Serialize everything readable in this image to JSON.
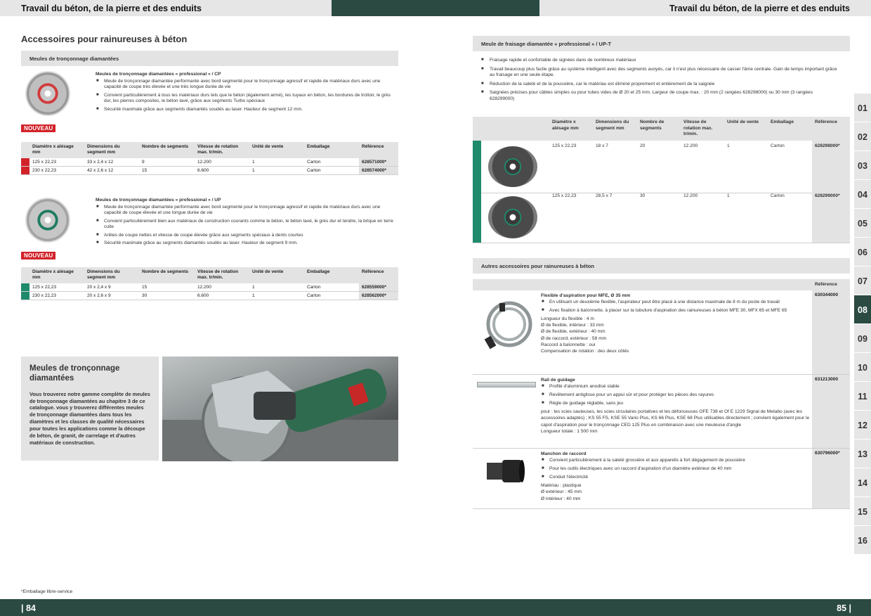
{
  "header": {
    "left_title": "Travail du béton, de la pierre et des enduits",
    "right_title": "Travail du béton, de la pierre et des enduits"
  },
  "left": {
    "section_title": "Accessoires pour rainureuses à béton",
    "subsection_bar": "Meules de tronçonnage diamantées",
    "cp": {
      "title": "Meules de tronçonnage diamantées « professional » / CP",
      "bullets": [
        "Meule de tronçonnage diamantée performante avec bord segmenté pour le tronçonnage agressif et rapide de matériaux durs avec une capacité de coupe très élevée et une très longue durée de vie",
        "Convient particulièrement à tous les matériaux durs tels que le béton (également armé), les tuyaux en béton, les bordures de trottoir, le grès dur, les pierres composites, le béton lavé, grâce aux segments Turbo spéciaux",
        "Sécurité maximale grâce aux segments diamantés soudés au laser. Hauteur de segment 12 mm."
      ],
      "badge": "NOUVEAU",
      "headers": [
        "Diamètre x alésage mm",
        "Dimensions du segment mm",
        "Nombre de segments",
        "Vitesse de rotation max. tr/min.",
        "Unité de vente",
        "Emballage",
        "Référence"
      ],
      "rows": [
        [
          "125 x 22,23",
          "33 x 2,4 x 12",
          "9",
          "12.200",
          "1",
          "Carton",
          "628571000*"
        ],
        [
          "230 x 22,23",
          "42 x 2,6 x 12",
          "15",
          "6.600",
          "1",
          "Carton",
          "628574000*"
        ]
      ]
    },
    "up": {
      "title": "Meules de tronçonnage diamantées « professional » / UP",
      "bullets": [
        "Meule de tronçonnage diamantée performante avec bord segmenté pour le tronçonnage agressif et rapide de matériaux durs avec une capacité de coupe élevée et une longue durée de vie",
        "Convient particulièrement bien aux matériaux de construction courants comme le béton, le béton lavé, le grès dur et tendre, la brique en terre cuite",
        "Arêtes de coupe nettes et vitesse de coupe élevée grâce aux segments spéciaux à dents courtes",
        "Sécurité maximale grâce au segments diamantés soudés au laser. Hauteur de segment 9 mm."
      ],
      "badge": "NOUVEAU",
      "headers": [
        "Diamètre x alésage mm",
        "Dimensions du segment mm",
        "Nombre de segments",
        "Vitesse de rotation max. tr/min.",
        "Unité de vente",
        "Emballage",
        "Référence"
      ],
      "rows": [
        [
          "125 x 22,23",
          "20 x 2,4 x 9",
          "15",
          "12.200",
          "1",
          "Carton",
          "628559000*"
        ],
        [
          "230 x 22,23",
          "20 x 2,6 x 9",
          "30",
          "6.600",
          "1",
          "Carton",
          "628562000*"
        ]
      ]
    },
    "promo": {
      "title": "Meules de tronçonnage diamantées",
      "text": "Vous trouverez notre gamme complète de meules de tronçonnage diamantées au chapitre 3 de ce catalogue. vous y trouverez différentes meules de tronçonnage diamantées dans tous les diamètres et les classes de qualité nécessaires pour toutes les applications comme la découpe de béton, de granit, de carrelage et d'autres matériaux de construction."
    },
    "footnote": "*Emballage libre-service",
    "page_number": "| 84"
  },
  "right": {
    "upt_bar": "Meule de fraisage diamantée « professional » / UP-T",
    "upt_bullets": [
      "Fraisage rapide et confortable de signées dans de nombreux matériaux",
      "Travail beaucoup plus facile grâce au système intelligent avec des segments avoyés, car il n'est plus nécessaire de casser l'âme centrale. Gain de temps important grâce au fraisage en une seule étape.",
      "Réduction de la saleté et de la poussière, car le matériau est éliminé proprement et entièrement de la saignée",
      "Saignées précises pour câbles simples ou pour tubes vides de Ø 20 et 25 mm. Largeur de coupe max. : 20 mm (2 rangées 628298000) ou 30 mm (3 rangées 628299000)"
    ],
    "upt_headers": [
      "Diamètre x alésage mm",
      "Dimensions du segment mm",
      "Nombre de segments",
      "Vitesse de rotation max. tr/min.",
      "Unité de vente",
      "Emballage",
      "Référence"
    ],
    "upt_rows": [
      [
        "125 x 22,23",
        "18 x 7",
        "20",
        "12.200",
        "1",
        "Carton",
        "628298000*"
      ],
      [
        "125 x 22,23",
        "28,5 x 7",
        "30",
        "12.200",
        "1",
        "Carton",
        "628299000*"
      ]
    ],
    "acc_bar": "Autres accessoires pour rainureuses à béton",
    "acc_ref_header": "Référence",
    "accessories": [
      {
        "title": "Flexible d'aspiration pour MFE, Ø 35 mm",
        "bullets": [
          "En utilisant un deuxième flexible, l'aspirateur peut être placé à une distance maximale de 8 m du poste de travail",
          "Avec fixation à baïonnette, à placer sur la tubulure d'aspiration des rainureuses à béton MFE 30, MFX 65 et MFE 65"
        ],
        "lines": [
          "Longueur du flexible : 4 m",
          "Ø de flexible, intérieur : 33 mm",
          "Ø de flexible, extérieur : 40 mm",
          "Ø de raccord, extérieur : 58 mm",
          "Raccord à baïonnette : oui",
          "Compensation de rotation : des deux côtés"
        ],
        "ref": "630344000"
      },
      {
        "title": "Rail de guidage",
        "bullets": [
          "Profilé d'aluminium anodisé stable",
          "Revêtement antiglisse pour un appui sûr et pour protéger les pièces des rayures",
          "Règle de guidage réglable, sans jeu"
        ],
        "lines": [
          "pour : les scies sauteuses, les scies circulaires portatives et les défonceuses OFE 738 et Of E 1229 Signal de Metabo (avec les accessoires adaptés) ; KS 55 FS, KSE 55 Vario Plus, KS 66 Plus, KSE 68 Plus utilisables directement ; convient également pour le capot d'aspiration pour le tronçonnage CED 125 Plus en combinaison avec une meuleuse d'angle",
          "Longueur totale : 1 500 mm"
        ],
        "ref": "631213000"
      },
      {
        "title": "Manchon de raccord",
        "bullets": [
          "Convient particulièrement à la saleté grossière et aux appareils à fort dégagement de poussière",
          "Pour les outils électriques avec un raccord d'aspiration d'un diamètre extérieur de 40 mm",
          "Conduit l'électricité"
        ],
        "lines": [
          "Matériau : plastique",
          "Ø extérieur : 45 mm",
          "Ø intérieur : 40 mm"
        ],
        "ref": "630796000*"
      }
    ],
    "page_number": "85 |"
  },
  "chapter_tabs": [
    "01",
    "02",
    "03",
    "04",
    "05",
    "06",
    "07",
    "08",
    "09",
    "10",
    "11",
    "12",
    "13",
    "14",
    "15",
    "16"
  ],
  "active_tab": "08",
  "colors": {
    "brand_dark": "#2b4a42",
    "accent_red": "#d2232a",
    "accent_teal": "#1f8a6c",
    "bar_gray": "#e3e3e3"
  }
}
